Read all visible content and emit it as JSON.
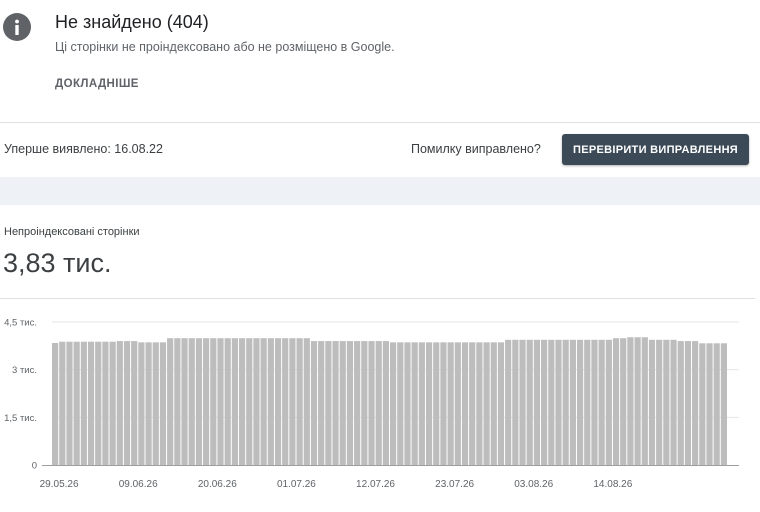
{
  "issue": {
    "title": "Не знайдено (404)",
    "subtitle": "Ці сторінки не проіндексовано або не розміщено в Google.",
    "more_link": "ДОКЛАДНІШЕ",
    "icon": "info-icon"
  },
  "status": {
    "first_detected": "Уперше виявлено: 16.08.22",
    "fixed_question": "Помилку виправлено?",
    "validate_button": "ПЕРЕВІРИТИ ВИПРАВЛЕННЯ"
  },
  "metric": {
    "label": "Непроіндексовані сторінки",
    "value": "3,83 тис."
  },
  "colors": {
    "bar": "#bdbdbd",
    "grid": "#e6e6e6",
    "button": "#3c4a57",
    "band": "#eef1f6"
  },
  "chart_data": {
    "type": "bar",
    "ylim": [
      0,
      4500
    ],
    "yticks": [
      {
        "value": 0,
        "label": "0"
      },
      {
        "value": 1500,
        "label": "1,5 тис."
      },
      {
        "value": 3000,
        "label": "3 тис."
      },
      {
        "value": 4500,
        "label": "4,5 тис."
      }
    ],
    "xticks": [
      {
        "index": 0,
        "label": "29.05.26"
      },
      {
        "index": 11,
        "label": "09.06.26"
      },
      {
        "index": 22,
        "label": "20.06.26"
      },
      {
        "index": 33,
        "label": "01.07.26"
      },
      {
        "index": 44,
        "label": "12.07.26"
      },
      {
        "index": 55,
        "label": "23.07.26"
      },
      {
        "index": 66,
        "label": "03.08.26"
      },
      {
        "index": 77,
        "label": "14.08.26"
      }
    ],
    "grid": true,
    "values": [
      3840,
      3880,
      3880,
      3880,
      3880,
      3880,
      3880,
      3880,
      3880,
      3900,
      3900,
      3900,
      3860,
      3860,
      3860,
      3860,
      3990,
      3990,
      3990,
      3990,
      3990,
      3990,
      3990,
      3990,
      3990,
      3990,
      3990,
      3990,
      3990,
      3990,
      3990,
      3990,
      3990,
      3990,
      3990,
      3990,
      3900,
      3900,
      3900,
      3900,
      3900,
      3900,
      3900,
      3900,
      3900,
      3900,
      3900,
      3860,
      3860,
      3860,
      3860,
      3860,
      3860,
      3860,
      3860,
      3860,
      3860,
      3860,
      3860,
      3860,
      3860,
      3860,
      3860,
      3940,
      3940,
      3940,
      3940,
      3940,
      3940,
      3940,
      3940,
      3940,
      3940,
      3940,
      3940,
      3940,
      3940,
      3940,
      3990,
      3990,
      4020,
      4020,
      4020,
      3940,
      3940,
      3940,
      3940,
      3900,
      3900,
      3900,
      3830,
      3830,
      3830,
      3830
    ]
  }
}
